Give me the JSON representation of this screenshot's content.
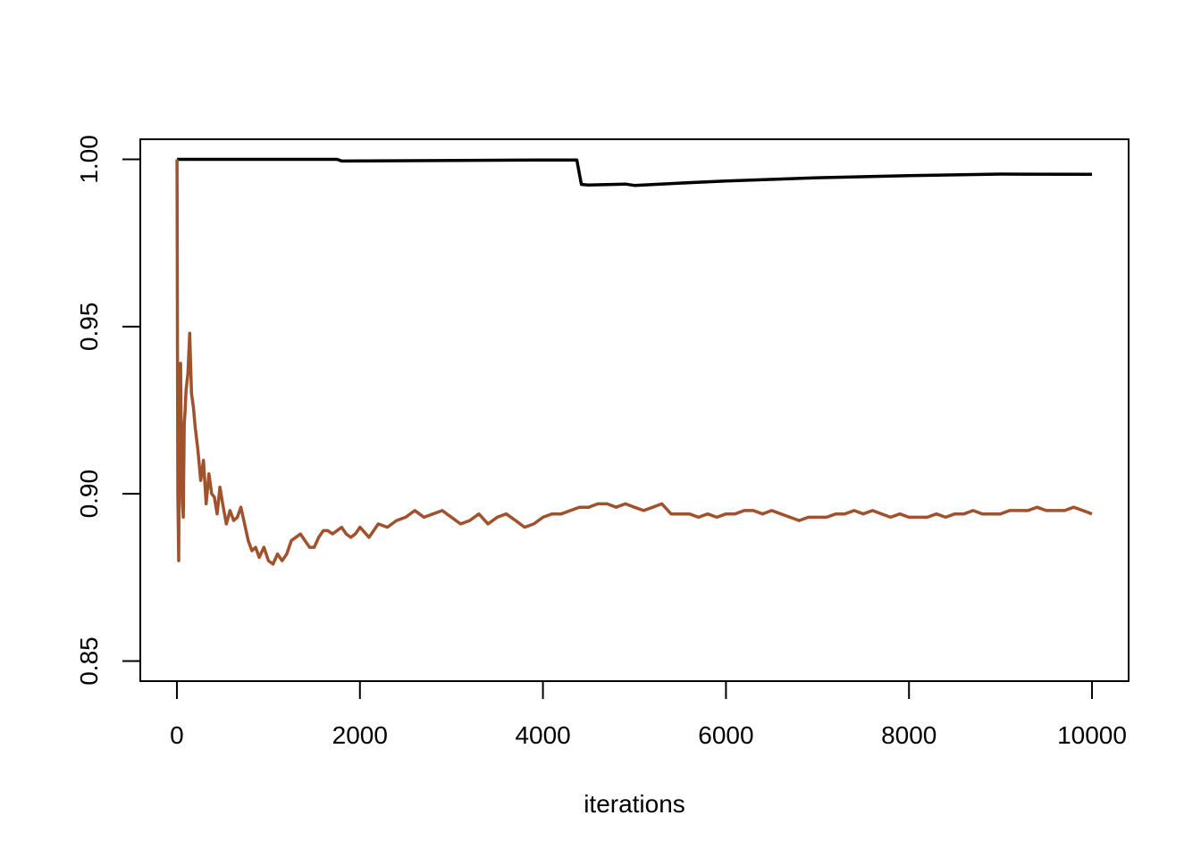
{
  "chart_data": {
    "type": "line",
    "title": "",
    "xlabel": "iterations",
    "ylabel": "",
    "xlim": [
      -400,
      10400
    ],
    "ylim": [
      0.844,
      1.006
    ],
    "grid": false,
    "legend": "none",
    "x_ticks": [
      0,
      2000,
      4000,
      6000,
      8000,
      10000
    ],
    "x_tick_labels": [
      "0",
      "2000",
      "4000",
      "6000",
      "8000",
      "10000"
    ],
    "y_ticks": [
      0.85,
      0.9,
      0.95,
      1.0
    ],
    "y_tick_labels": [
      "0.85",
      "0.90",
      "0.95",
      "1.00"
    ],
    "series": [
      {
        "name": "series-black",
        "color": "#000000",
        "x": [
          1,
          20,
          1750,
          1800,
          3900,
          4370,
          4420,
          4500,
          4900,
          5000,
          5500,
          6000,
          7000,
          8000,
          9000,
          10000
        ],
        "y": [
          1.0,
          1.0,
          1.0,
          0.9995,
          0.9998,
          0.9998,
          0.9925,
          0.9923,
          0.9926,
          0.9922,
          0.9929,
          0.9935,
          0.9945,
          0.9951,
          0.9956,
          0.9955
        ]
      },
      {
        "name": "series-brown",
        "color": "#A0522D",
        "x": [
          1,
          10,
          20,
          30,
          40,
          50,
          60,
          70,
          80,
          90,
          100,
          120,
          140,
          160,
          180,
          200,
          230,
          260,
          290,
          320,
          350,
          380,
          410,
          440,
          470,
          500,
          540,
          580,
          620,
          660,
          700,
          740,
          780,
          820,
          860,
          900,
          950,
          1000,
          1050,
          1100,
          1150,
          1200,
          1250,
          1300,
          1350,
          1400,
          1450,
          1500,
          1550,
          1600,
          1650,
          1700,
          1750,
          1800,
          1850,
          1900,
          1950,
          2000,
          2100,
          2200,
          2300,
          2400,
          2500,
          2600,
          2700,
          2800,
          2900,
          3000,
          3100,
          3200,
          3300,
          3400,
          3500,
          3600,
          3700,
          3800,
          3900,
          4000,
          4100,
          4200,
          4300,
          4400,
          4500,
          4600,
          4700,
          4800,
          4900,
          5000,
          5100,
          5200,
          5300,
          5400,
          5500,
          5600,
          5700,
          5800,
          5900,
          6000,
          6100,
          6200,
          6300,
          6400,
          6500,
          6600,
          6700,
          6800,
          6900,
          7000,
          7100,
          7200,
          7300,
          7400,
          7500,
          7600,
          7700,
          7800,
          7900,
          8000,
          8100,
          8200,
          8300,
          8400,
          8500,
          8600,
          8700,
          8800,
          8900,
          9000,
          9100,
          9200,
          9300,
          9400,
          9500,
          9600,
          9700,
          9800,
          9900,
          10000
        ],
        "y": [
          1.0,
          0.9,
          0.88,
          0.935,
          0.939,
          0.908,
          0.897,
          0.893,
          0.921,
          0.925,
          0.931,
          0.936,
          0.948,
          0.93,
          0.926,
          0.92,
          0.913,
          0.904,
          0.91,
          0.897,
          0.906,
          0.9,
          0.899,
          0.894,
          0.902,
          0.897,
          0.891,
          0.895,
          0.892,
          0.893,
          0.896,
          0.891,
          0.886,
          0.883,
          0.884,
          0.881,
          0.884,
          0.88,
          0.879,
          0.882,
          0.88,
          0.882,
          0.886,
          0.887,
          0.888,
          0.886,
          0.884,
          0.884,
          0.887,
          0.889,
          0.889,
          0.888,
          0.889,
          0.89,
          0.888,
          0.887,
          0.888,
          0.89,
          0.887,
          0.891,
          0.89,
          0.892,
          0.893,
          0.895,
          0.893,
          0.894,
          0.895,
          0.893,
          0.891,
          0.892,
          0.894,
          0.891,
          0.893,
          0.894,
          0.892,
          0.89,
          0.891,
          0.893,
          0.894,
          0.894,
          0.895,
          0.896,
          0.896,
          0.897,
          0.897,
          0.896,
          0.897,
          0.896,
          0.895,
          0.896,
          0.897,
          0.894,
          0.894,
          0.894,
          0.893,
          0.894,
          0.893,
          0.894,
          0.894,
          0.895,
          0.895,
          0.894,
          0.895,
          0.894,
          0.893,
          0.892,
          0.893,
          0.893,
          0.893,
          0.894,
          0.894,
          0.895,
          0.894,
          0.895,
          0.894,
          0.893,
          0.894,
          0.893,
          0.893,
          0.893,
          0.894,
          0.893,
          0.894,
          0.894,
          0.895,
          0.894,
          0.894,
          0.894,
          0.895,
          0.895,
          0.895,
          0.896,
          0.895,
          0.895,
          0.895,
          0.896,
          0.895,
          0.894,
          0.895,
          0.894
        ]
      }
    ]
  }
}
